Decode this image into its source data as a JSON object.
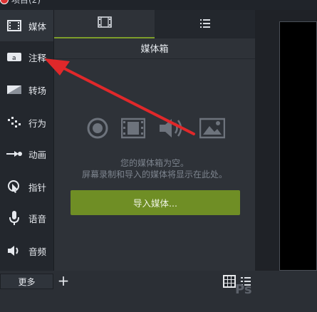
{
  "window": {
    "title": "项目(2)"
  },
  "sidebar": {
    "items": [
      {
        "label": "媒体",
        "icon": "film-icon"
      },
      {
        "label": "注释",
        "icon": "annotation-icon"
      },
      {
        "label": "转场",
        "icon": "transition-icon"
      },
      {
        "label": "行为",
        "icon": "behavior-icon"
      },
      {
        "label": "动画",
        "icon": "animation-icon"
      },
      {
        "label": "指针",
        "icon": "cursor-icon"
      },
      {
        "label": "语音",
        "icon": "microphone-icon"
      },
      {
        "label": "音频",
        "icon": "speaker-icon"
      }
    ],
    "more_label": "更多",
    "add_label": "+"
  },
  "panel": {
    "tabs": [
      {
        "icon": "film-strip-icon"
      },
      {
        "icon": "list-icon"
      }
    ],
    "title": "媒体箱",
    "empty_line1": "您的媒体箱为空。",
    "empty_line2": "屏幕录制和导入的媒体将显示在此处。",
    "import_label": "导入媒体...",
    "media_icons": [
      "record-icon",
      "video-icon",
      "audio-icon",
      "image-icon"
    ]
  },
  "colors": {
    "accent": "#6f8e25",
    "annotation_arrow": "#e0282a"
  },
  "watermark": "Ps"
}
